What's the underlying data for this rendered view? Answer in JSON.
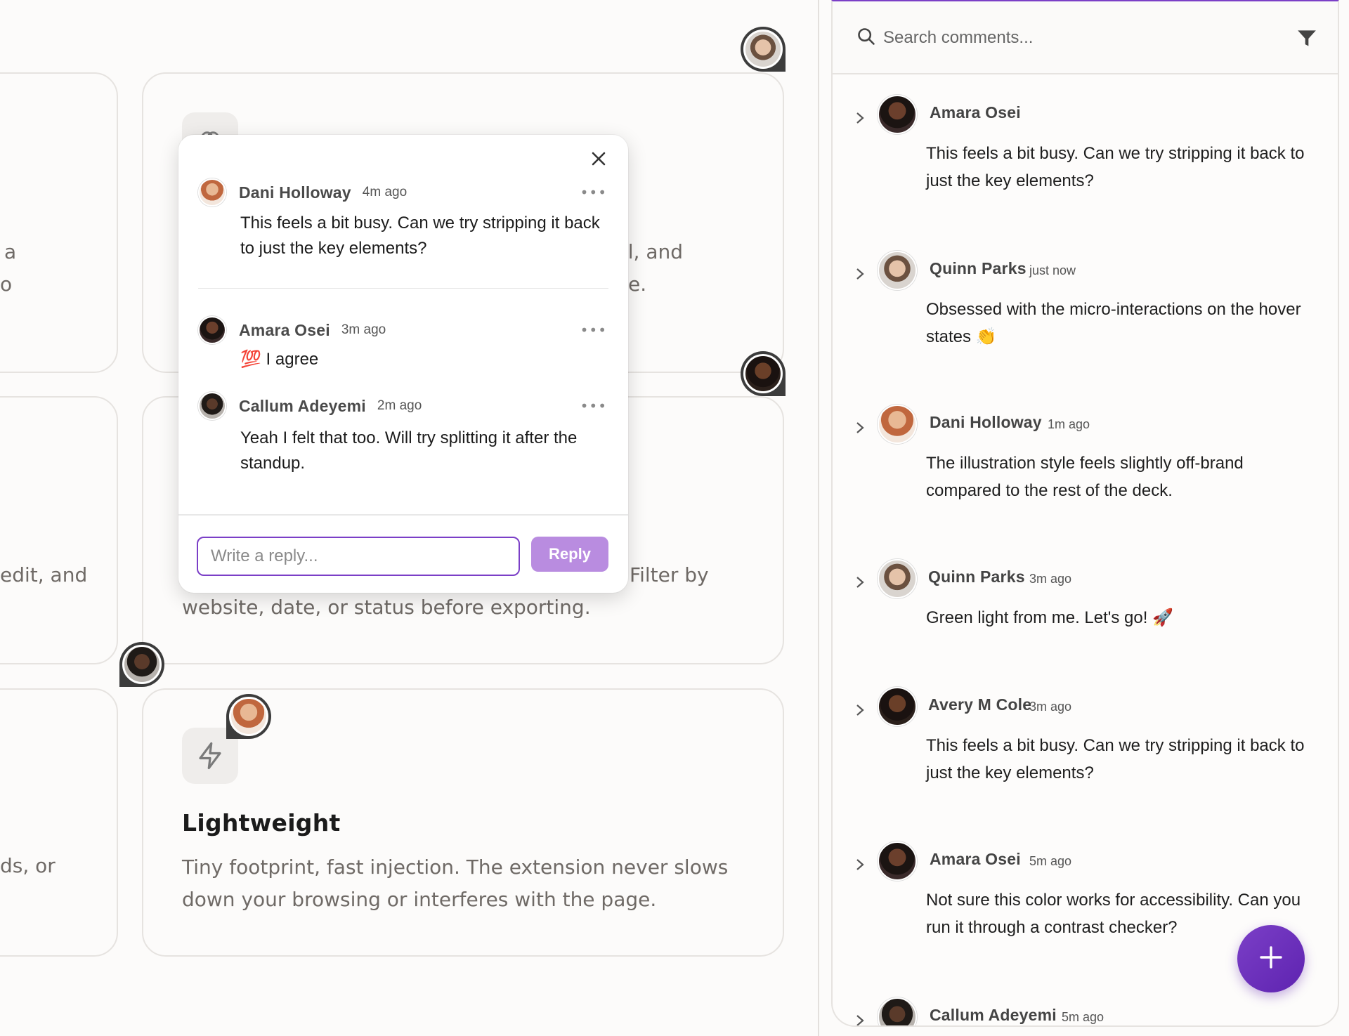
{
  "background_cards": {
    "left_fragments": [
      "a",
      "o",
      "edit, and",
      "ds, or"
    ],
    "middle_fragments": [
      "il, and",
      "e.",
      "Filter by"
    ],
    "card2_desc_line2": "website, date, or status before exporting.",
    "lightweight": {
      "icon": "lightning-icon",
      "title": "Lightweight",
      "description": "Tiny footprint, fast injection. The extension never slows down your browsing or interferes with the page."
    }
  },
  "popover": {
    "close_icon": "close-icon",
    "messages": [
      {
        "author": "Dani Holloway",
        "time": "4m ago",
        "text": "This feels a bit busy. Can we try stripping it back to just the key elements?",
        "avatar": "dani"
      },
      {
        "author": "Amara Osei",
        "time": "3m ago",
        "text": "💯 I agree",
        "avatar": "amara"
      },
      {
        "author": "Callum Adeyemi",
        "time": "2m ago",
        "text": "Yeah I felt that too. Will try splitting it after the standup.",
        "avatar": "callum"
      }
    ],
    "more_label": "•••",
    "reply_placeholder": "Write a reply...",
    "reply_button": "Reply"
  },
  "sidebar": {
    "search_placeholder": "Search comments...",
    "comments": [
      {
        "author": "Amara Osei",
        "time": "",
        "text": "This feels a bit busy. Can we try stripping it back to just the key elements?",
        "avatar": "amara"
      },
      {
        "author": "Quinn Parks",
        "time": "just now",
        "text": "Obsessed with the micro-interactions on the hover states 👏",
        "avatar": "quinn"
      },
      {
        "author": "Dani Holloway",
        "time": "1m ago",
        "text": "The illustration style feels slightly off-brand compared to the rest of the deck.",
        "avatar": "dani"
      },
      {
        "author": "Quinn Parks",
        "time": "3m ago",
        "text": "Green light from me. Let's go! 🚀",
        "avatar": "quinn"
      },
      {
        "author": "Avery M Cole",
        "time": "3m ago",
        "text": "This feels a bit busy. Can we try stripping it back to just the key elements?",
        "avatar": "avery"
      },
      {
        "author": "Amara Osei",
        "time": "5m ago",
        "text": "Not sure this color works for accessibility. Can you run it through a contrast checker?",
        "avatar": "amara"
      },
      {
        "author": "Callum Adeyemi",
        "time": "5m ago",
        "text": "",
        "avatar": "callum"
      }
    ]
  },
  "fab": {
    "icon": "plus-icon"
  },
  "colors": {
    "accent": "#7b3fc7",
    "reply_button": "#b98ce0"
  }
}
